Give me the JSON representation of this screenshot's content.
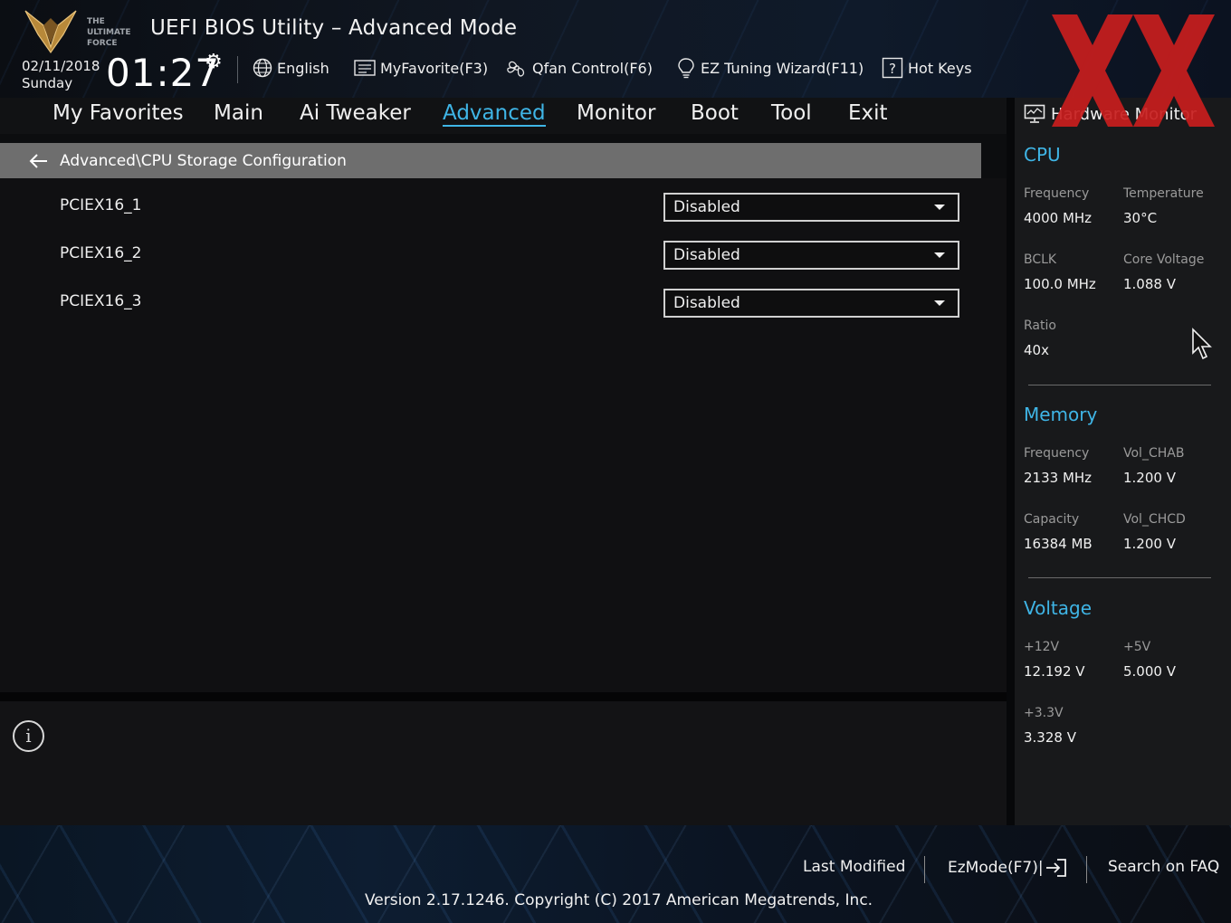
{
  "header": {
    "app_title": "UEFI BIOS Utility – Advanced Mode",
    "date": "02/11/2018",
    "day": "Sunday",
    "time": "01:27",
    "tools": [
      {
        "label": "English",
        "icon": "globe-icon"
      },
      {
        "label": "MyFavorite(F3)",
        "icon": "favorite-list-icon"
      },
      {
        "label": "Qfan Control(F6)",
        "icon": "fan-icon"
      },
      {
        "label": "EZ Tuning Wizard(F11)",
        "icon": "lightbulb-icon"
      },
      {
        "label": "Hot Keys",
        "icon": "help-box-icon"
      }
    ]
  },
  "nav": {
    "tabs": [
      "My Favorites",
      "Main",
      "Ai Tweaker",
      "Advanced",
      "Monitor",
      "Boot",
      "Tool",
      "Exit"
    ],
    "active": "Advanced"
  },
  "breadcrumb": "Advanced\\CPU Storage Configuration",
  "settings": [
    {
      "label": "PCIEX16_1",
      "value": "Disabled"
    },
    {
      "label": "PCIEX16_2",
      "value": "Disabled"
    },
    {
      "label": "PCIEX16_3",
      "value": "Disabled"
    }
  ],
  "hardware_monitor": {
    "title": "Hardware Monitor",
    "cpu": {
      "title": "CPU",
      "frequency_label": "Frequency",
      "frequency": "4000 MHz",
      "temperature_label": "Temperature",
      "temperature": "30°C",
      "bclk_label": "BCLK",
      "bclk": "100.0 MHz",
      "core_voltage_label": "Core Voltage",
      "core_voltage": "1.088 V",
      "ratio_label": "Ratio",
      "ratio": "40x"
    },
    "memory": {
      "title": "Memory",
      "frequency_label": "Frequency",
      "frequency": "2133 MHz",
      "vol_chab_label": "Vol_CHAB",
      "vol_chab": "1.200 V",
      "capacity_label": "Capacity",
      "capacity": "16384 MB",
      "vol_chcd_label": "Vol_CHCD",
      "vol_chcd": "1.200 V"
    },
    "voltage": {
      "title": "Voltage",
      "v12_label": "+12V",
      "v12": "12.192 V",
      "v5_label": "+5V",
      "v5": "5.000 V",
      "v33_label": "+3.3V",
      "v33": "3.328 V"
    }
  },
  "footer": {
    "last_modified": "Last Modified",
    "ezmode": "EzMode(F7)|",
    "search_faq": "Search on FAQ",
    "version": "Version 2.17.1246. Copyright (C) 2017 American Megatrends, Inc."
  },
  "colors": {
    "accent": "#3fb5e6",
    "watermark_red": "#c81e1e"
  }
}
